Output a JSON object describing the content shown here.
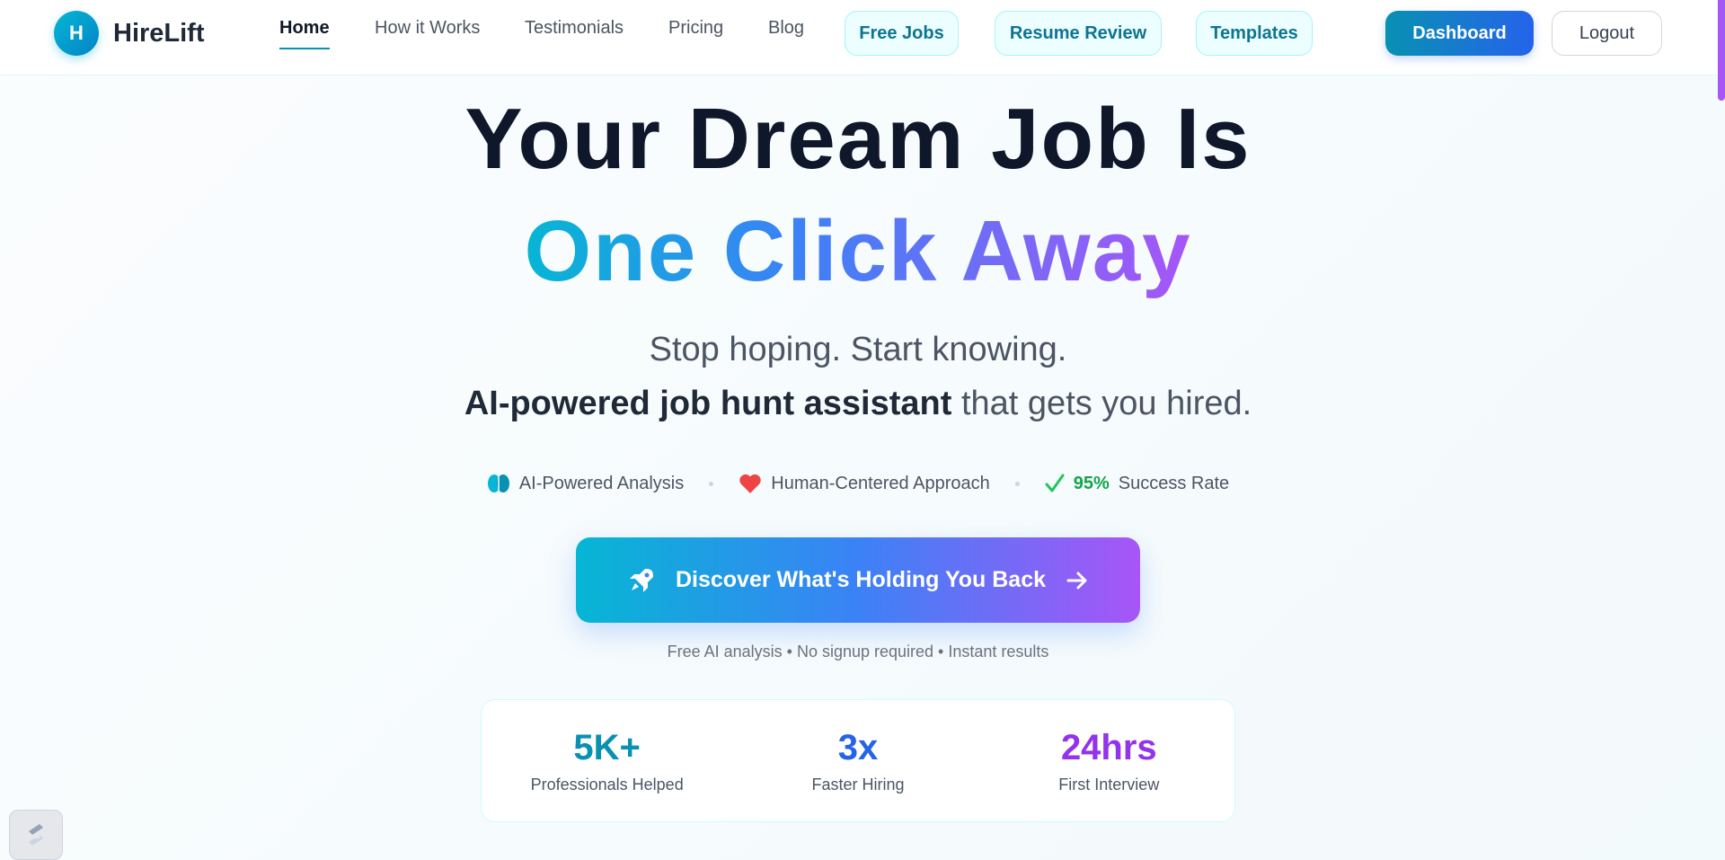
{
  "brand": {
    "logo_letter": "H",
    "name": "HireLift"
  },
  "nav": {
    "home": "Home",
    "how_it_works": "How it Works",
    "testimonials": "Testimonials",
    "pricing": "Pricing",
    "blog": "Blog"
  },
  "pills": {
    "free_jobs": "Free Jobs",
    "resume_review": "Resume Review",
    "templates": "Templates"
  },
  "actions": {
    "dashboard": "Dashboard",
    "logout": "Logout"
  },
  "hero": {
    "line1": "Your Dream Job Is",
    "line2": "One Click Away",
    "sub1": "Stop hoping. Start knowing.",
    "sub2_bold": "AI-powered job hunt assistant",
    "sub2_rest": " that gets you hired."
  },
  "features": {
    "ai": "AI-Powered Analysis",
    "human": "Human-Centered Approach",
    "rate_value": "95%",
    "rate_label": "Success Rate"
  },
  "cta": {
    "label": "Discover What's Holding You Back",
    "note": "Free AI analysis • No signup required • Instant results"
  },
  "stats": [
    {
      "value": "5K+",
      "label": "Professionals Helped",
      "color": "#0891b2"
    },
    {
      "value": "3x",
      "label": "Faster Hiring",
      "color": "#2563eb"
    },
    {
      "value": "24hrs",
      "label": "First Interview",
      "color": "#9333ea"
    }
  ],
  "icons": {
    "brain": "brain-icon",
    "heart": "heart-icon",
    "check": "check-icon",
    "rocket": "rocket-icon",
    "arrow": "arrow-right-icon",
    "widget": "app-widget-icon"
  }
}
